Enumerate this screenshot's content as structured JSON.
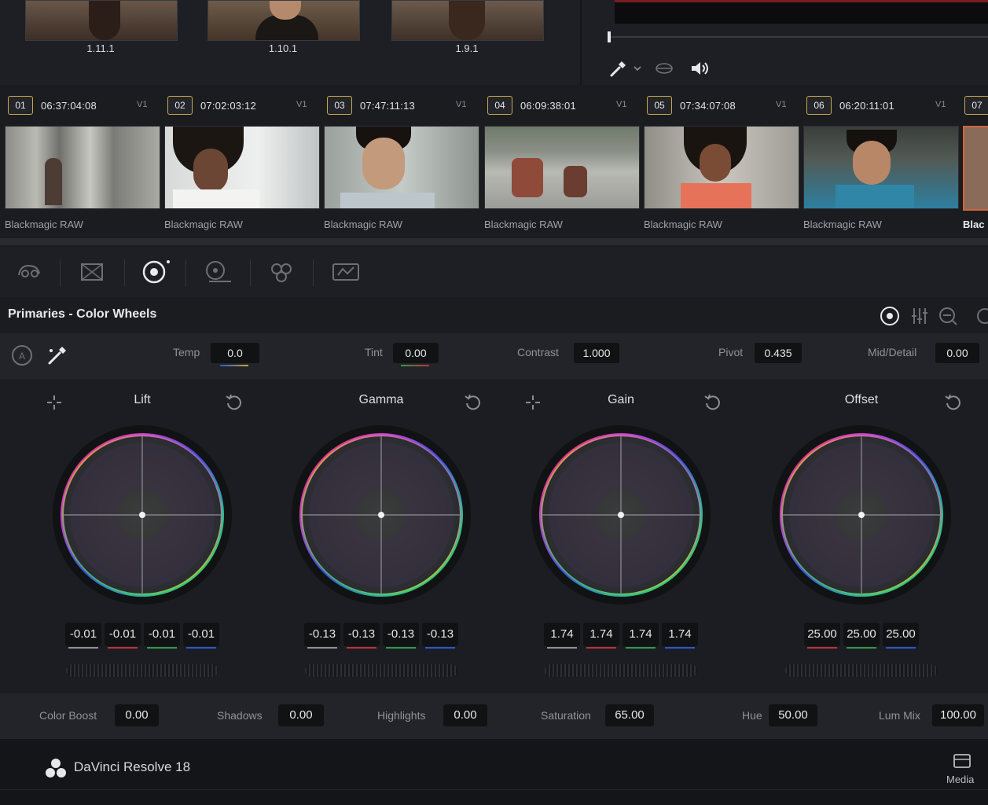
{
  "preview_clips": [
    {
      "label": "1.11.1"
    },
    {
      "label": "1.10.1"
    },
    {
      "label": "1.9.1"
    }
  ],
  "clips": [
    {
      "num": "01",
      "timecode": "06:37:04:08",
      "track": "V1",
      "codec": "Blackmagic RAW"
    },
    {
      "num": "02",
      "timecode": "07:02:03:12",
      "track": "V1",
      "codec": "Blackmagic RAW"
    },
    {
      "num": "03",
      "timecode": "07:47:11:13",
      "track": "V1",
      "codec": "Blackmagic RAW"
    },
    {
      "num": "04",
      "timecode": "06:09:38:01",
      "track": "V1",
      "codec": "Blackmagic RAW"
    },
    {
      "num": "05",
      "timecode": "07:34:07:08",
      "track": "V1",
      "codec": "Blackmagic RAW"
    },
    {
      "num": "06",
      "timecode": "06:20:11:01",
      "track": "V1",
      "codec": "Blackmagic RAW"
    },
    {
      "num": "07",
      "timecode": "",
      "track": "",
      "codec": "Blac"
    }
  ],
  "panel": {
    "title": "Primaries - Color Wheels"
  },
  "adjust": {
    "temp_label": "Temp",
    "temp_value": "0.0",
    "tint_label": "Tint",
    "tint_value": "0.00",
    "contrast_label": "Contrast",
    "contrast_value": "1.000",
    "pivot_label": "Pivot",
    "pivot_value": "0.435",
    "middetail_label": "Mid/Detail",
    "middetail_value": "0.00"
  },
  "wheels": [
    {
      "name": "Lift",
      "values": [
        "-0.01",
        "-0.01",
        "-0.01",
        "-0.01"
      ]
    },
    {
      "name": "Gamma",
      "values": [
        "-0.13",
        "-0.13",
        "-0.13",
        "-0.13"
      ]
    },
    {
      "name": "Gain",
      "values": [
        "1.74",
        "1.74",
        "1.74",
        "1.74"
      ]
    },
    {
      "name": "Offset",
      "values": [
        "25.00",
        "25.00",
        "25.00"
      ]
    }
  ],
  "bottom": {
    "colorboost_label": "Color Boost",
    "colorboost_value": "0.00",
    "shadows_label": "Shadows",
    "shadows_value": "0.00",
    "highlights_label": "Highlights",
    "highlights_value": "0.00",
    "saturation_label": "Saturation",
    "saturation_value": "65.00",
    "hue_label": "Hue",
    "hue_value": "50.00",
    "lummix_label": "Lum Mix",
    "lummix_value": "100.00"
  },
  "footer": {
    "app_name": "DaVinci Resolve 18",
    "media_label": "Media"
  },
  "colors": {
    "accent_yellow": "#c4a84a",
    "red": "#c0303a",
    "green": "#2f9a4a",
    "blue": "#2a58c8"
  }
}
